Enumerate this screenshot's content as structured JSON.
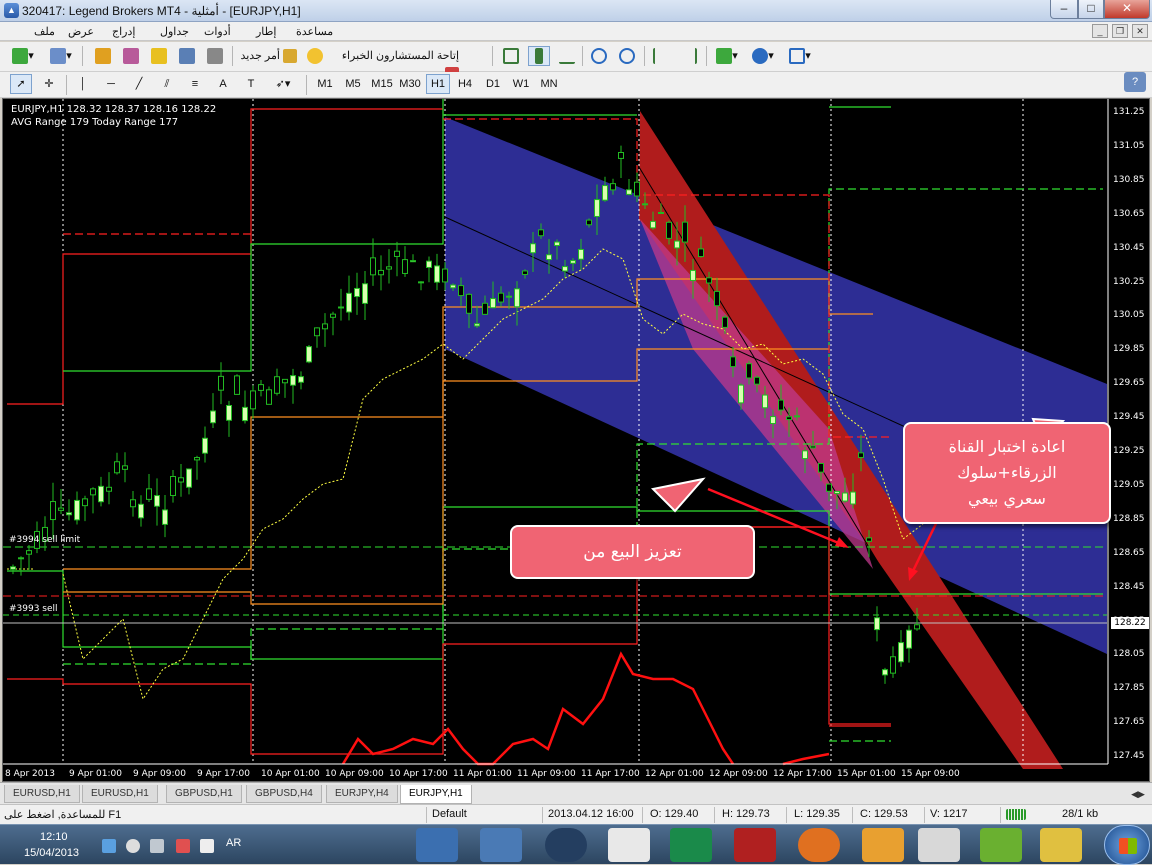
{
  "window": {
    "title": "320417: Legend Brokers MT4 - أمثلية - [EURJPY,H1]",
    "min": "–",
    "max": "□",
    "close": "✕"
  },
  "menu": [
    "ملف",
    "عرض",
    "إدراج",
    "جداول",
    "أدوات",
    "إطار",
    "مساعدة"
  ],
  "toolbar1": {
    "expert_advisors_label": "إتاحة المستشارون الخبراء",
    "new_order_label": "أمر جديد"
  },
  "timeframes": [
    "M1",
    "M5",
    "M15",
    "M30",
    "H1",
    "H4",
    "D1",
    "W1",
    "MN"
  ],
  "active_timeframe": "H1",
  "chart": {
    "info_line1": "EURJPY,H1  128.32 128.37 128.16 128.22",
    "info_line2": "AVG Range 179    Today Range 177",
    "order_sell_limit": "#3994 sell limit",
    "order_sell": "#3993 sell",
    "current_price": "128.22",
    "price_ticks": [
      "131.25",
      "131.05",
      "130.85",
      "130.65",
      "130.45",
      "130.25",
      "130.05",
      "129.85",
      "129.65",
      "129.45",
      "129.25",
      "129.05",
      "128.85",
      "128.65",
      "128.45",
      "128.25",
      "128.05",
      "127.85",
      "127.65",
      "127.45"
    ],
    "time_ticks": [
      "8 Apr 2013",
      "9 Apr 01:00",
      "9 Apr 09:00",
      "9 Apr 17:00",
      "10 Apr 01:00",
      "10 Apr 09:00",
      "10 Apr 17:00",
      "11 Apr 01:00",
      "11 Apr 09:00",
      "11 Apr 17:00",
      "12 Apr 01:00",
      "12 Apr 09:00",
      "12 Apr 17:00",
      "15 Apr 01:00",
      "15 Apr 09:00"
    ],
    "callout1": "تعزيز البيع من",
    "callout2": "اعادة اختبار القناة\nالزرقاء+سلوك\nسعري بيعي",
    "colors": {
      "blue_channel": "#2f2f9c",
      "red_channel": "#b01c1c",
      "bull_candle": "#d8ffb0",
      "bear_candle": "#22aa22",
      "callout": "#f06473"
    }
  },
  "tabs": [
    "EURUSD,H1",
    "EURUSD,H1",
    "GBPUSD,H1",
    "GBPUSD,H4",
    "EURJPY,H4",
    "EURJPY,H1"
  ],
  "active_tab": "EURJPY,H1",
  "status": {
    "help": "للمساعدة, اضغط على F1",
    "profile": "Default",
    "datetime": "2013.04.12 16:00",
    "open": "O: 129.40",
    "high": "H: 129.73",
    "low": "L: 129.35",
    "close": "C: 129.53",
    "volume": "V: 1217",
    "traffic": "28/1 kb"
  },
  "taskbar": {
    "time": "12:10",
    "date": "15/04/2013",
    "lang": "AR"
  }
}
